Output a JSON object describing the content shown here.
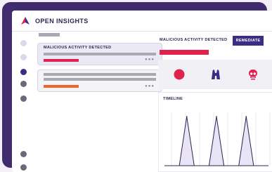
{
  "app": {
    "title": "OPEN INSIGHTS"
  },
  "sidebar": {
    "items": [
      {
        "icon": "nav-dot",
        "state": "inactive"
      },
      {
        "icon": "nav-dot",
        "state": "inactive"
      },
      {
        "icon": "nav-dot",
        "state": "active"
      },
      {
        "icon": "nav-dot",
        "state": "default"
      },
      {
        "icon": "nav-dot",
        "state": "default"
      },
      {
        "icon": "nav-dot",
        "state": "default"
      },
      {
        "icon": "nav-dot",
        "state": "default"
      }
    ]
  },
  "alerts": [
    {
      "title": "MALICIOUS ACTIVITY DETECTED",
      "severity_color": "#e0224f",
      "more": "●●●",
      "selected": true
    },
    {
      "title": "",
      "severity_color": "#f0642d",
      "more": "●●●",
      "selected": false
    }
  ],
  "detail": {
    "title": "MALICIOUS ACTIVITY DETECTED",
    "remediate_label": "REMEDIATE",
    "severity_color": "#e0224f",
    "icons": [
      "alert-dot-icon",
      "binoculars-icon",
      "skull-icon"
    ],
    "timeline_label": "TIMELINE"
  },
  "colors": {
    "accent": "#3c2c83",
    "critical": "#e0224f",
    "warning": "#f0642d",
    "frame": "#3f2b6e"
  },
  "chart_data": {
    "type": "line",
    "title": "TIMELINE",
    "x": [
      0,
      1,
      2,
      3,
      4,
      5,
      6,
      7,
      8,
      9,
      10,
      11,
      12,
      13,
      14
    ],
    "y": [
      0,
      0,
      0,
      5,
      0,
      0,
      0,
      5,
      0,
      0,
      0,
      5,
      0,
      0,
      0
    ],
    "ylim": [
      0,
      6
    ],
    "grid": "vertical"
  }
}
